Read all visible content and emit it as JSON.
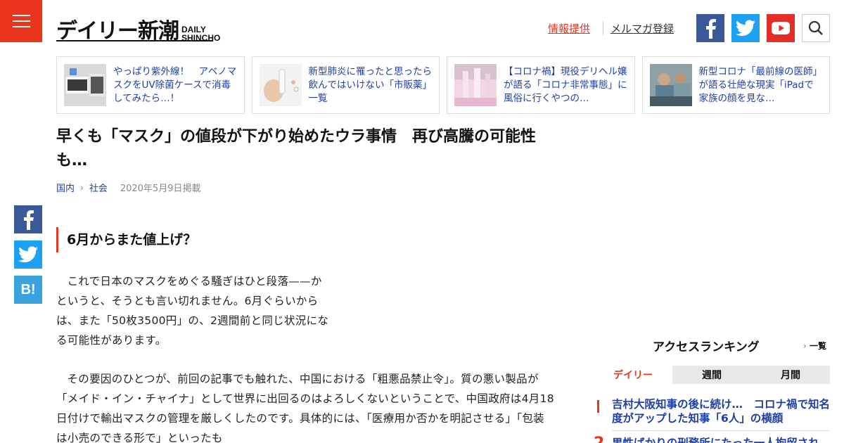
{
  "header": {
    "logo_jp": "デイリー新潮",
    "logo_en_1": "DAILY",
    "logo_en_2": "SHINCHO",
    "link_info": "情報提供",
    "link_mail": "メルマガ登録"
  },
  "related": [
    {
      "text": "やっぱり紫外線！　アベノマスクをUV除菌ケースで消毒してみたら…！"
    },
    {
      "text": "新型肺炎に罹ったと思ったら飲んではいけない「市販薬」一覧"
    },
    {
      "text": "【コロナ禍】現役デリヘル嬢が語る「コロナ非常事態」に風俗に行くやつの…"
    },
    {
      "text": "新型コロナ「最前線の医師」が語る壮絶な現実「iPadで家族の顔を見な…"
    }
  ],
  "article": {
    "title": "早くも「マスク」の値段が下がり始めたウラ事情　再び高騰の可能性も…",
    "crumb_1": "国内",
    "crumb_2": "社会",
    "date": "2020年5月9日掲載",
    "subhead": "6月からまた値上げ？",
    "para1": "これで日本のマスクをめぐる騒ぎはひと段落——かというと、そうとも言い切れません。6月ぐらいからは、また「50枚3500円」の、2週間前と同じ状況になる可能性があります。",
    "para2": "その要因のひとつが、前回の記事でも触れた、中国における「粗悪品禁止令」。質の悪い製品が「メイド・イン・チャイナ」として世界に出回るのはよろしくないということで、中国政府は4月18日付けで輸出マスクの管理を厳しくしたのです。具体的には、「医療用か否かを明記させる」「包装は小売のできる形で」といったも"
  },
  "ranking": {
    "title": "アクセスランキング",
    "more": "一覧",
    "tabs": [
      "デイリー",
      "週間",
      "月間"
    ],
    "items": [
      {
        "num": "1",
        "text": "吉村大阪知事の後に続け…　コロナ禍で知名度がアップした知事「6人」の横顔"
      },
      {
        "num": "2",
        "text": "男性ばかりの刑務所にたった一人拘留された女性"
      }
    ]
  },
  "colors": {
    "accent": "#e8351c",
    "link": "#1f3fa8",
    "facebook": "#3b5998",
    "twitter": "#1da1f2",
    "youtube": "#e52d27"
  }
}
